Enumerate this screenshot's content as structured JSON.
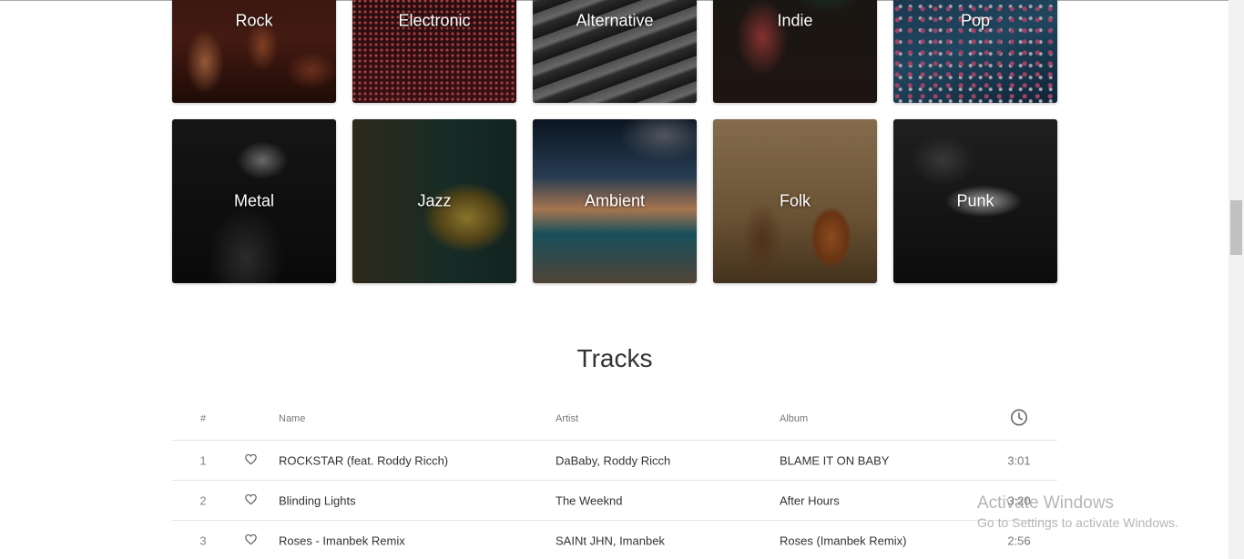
{
  "genres": [
    {
      "label": "Rock",
      "bg": "bg-rock",
      "name": "genre-tile-rock"
    },
    {
      "label": "Electronic",
      "bg": "bg-electronic",
      "name": "genre-tile-electronic"
    },
    {
      "label": "Alternative",
      "bg": "bg-alternative",
      "name": "genre-tile-alternative"
    },
    {
      "label": "Indie",
      "bg": "bg-indie",
      "name": "genre-tile-indie"
    },
    {
      "label": "Pop",
      "bg": "bg-pop",
      "name": "genre-tile-pop"
    },
    {
      "label": "Metal",
      "bg": "bg-metal",
      "name": "genre-tile-metal"
    },
    {
      "label": "Jazz",
      "bg": "bg-jazz",
      "name": "genre-tile-jazz"
    },
    {
      "label": "Ambient",
      "bg": "bg-ambient",
      "name": "genre-tile-ambient"
    },
    {
      "label": "Folk",
      "bg": "bg-folk",
      "name": "genre-tile-folk"
    },
    {
      "label": "Punk",
      "bg": "bg-punk",
      "name": "genre-tile-punk"
    }
  ],
  "tracks": {
    "title": "Tracks",
    "headers": {
      "num": "#",
      "name": "Name",
      "artist": "Artist",
      "album": "Album",
      "duration_icon": "clock-icon"
    },
    "rows": [
      {
        "num": "1",
        "name": "ROCKSTAR (feat. Roddy Ricch)",
        "artist": "DaBaby, Roddy Ricch",
        "album": "BLAME IT ON BABY",
        "duration": "3:01"
      },
      {
        "num": "2",
        "name": "Blinding Lights",
        "artist": "The Weeknd",
        "album": "After Hours",
        "duration": "3:20"
      },
      {
        "num": "3",
        "name": "Roses - Imanbek Remix",
        "artist": "SAINt JHN, Imanbek",
        "album": "Roses (Imanbek Remix)",
        "duration": "2:56"
      }
    ]
  },
  "watermark": {
    "line1": "Activate Windows",
    "line2": "Go to Settings to activate Windows."
  }
}
